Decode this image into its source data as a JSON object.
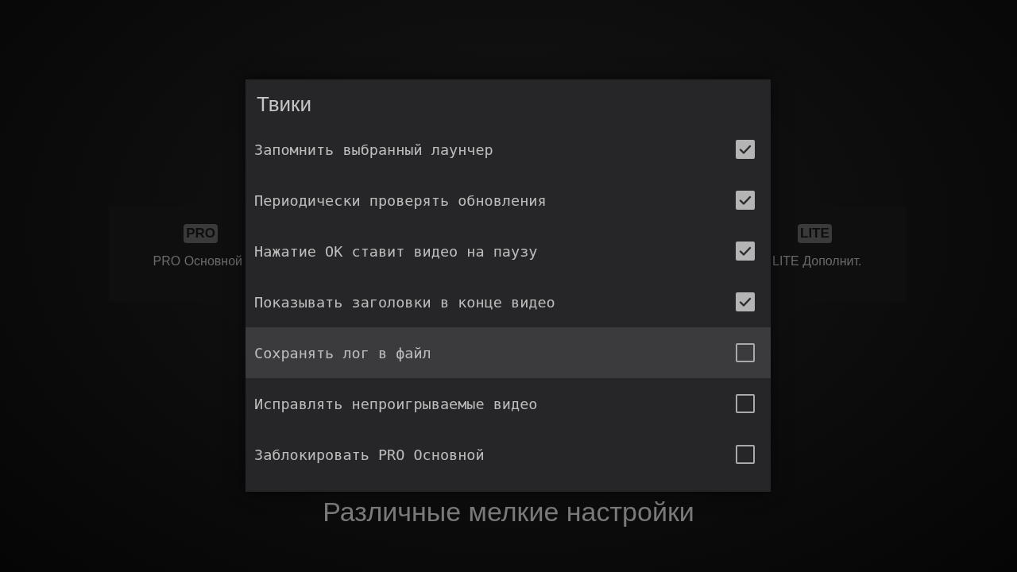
{
  "background": {
    "cards": [
      {
        "badge": "PRO",
        "label": "PRO Основной"
      },
      {
        "badge": "LITE",
        "label": "LITE Дополнит."
      }
    ],
    "subtitle": "Различные мелкие настройки"
  },
  "dialog": {
    "title": "Твики",
    "items": [
      {
        "label": "Запомнить выбранный лаунчер",
        "checked": true,
        "selected": false
      },
      {
        "label": "Периодически проверять обновления",
        "checked": true,
        "selected": false
      },
      {
        "label": "Нажатие OK ставит видео на паузу",
        "checked": true,
        "selected": false
      },
      {
        "label": "Показывать заголовки в конце видео",
        "checked": true,
        "selected": false
      },
      {
        "label": "Сохранять лог в файл",
        "checked": false,
        "selected": true
      },
      {
        "label": "Исправлять непроигрываемые видео",
        "checked": false,
        "selected": false
      },
      {
        "label": "Заблокировать PRO Основной",
        "checked": false,
        "selected": false
      }
    ]
  }
}
